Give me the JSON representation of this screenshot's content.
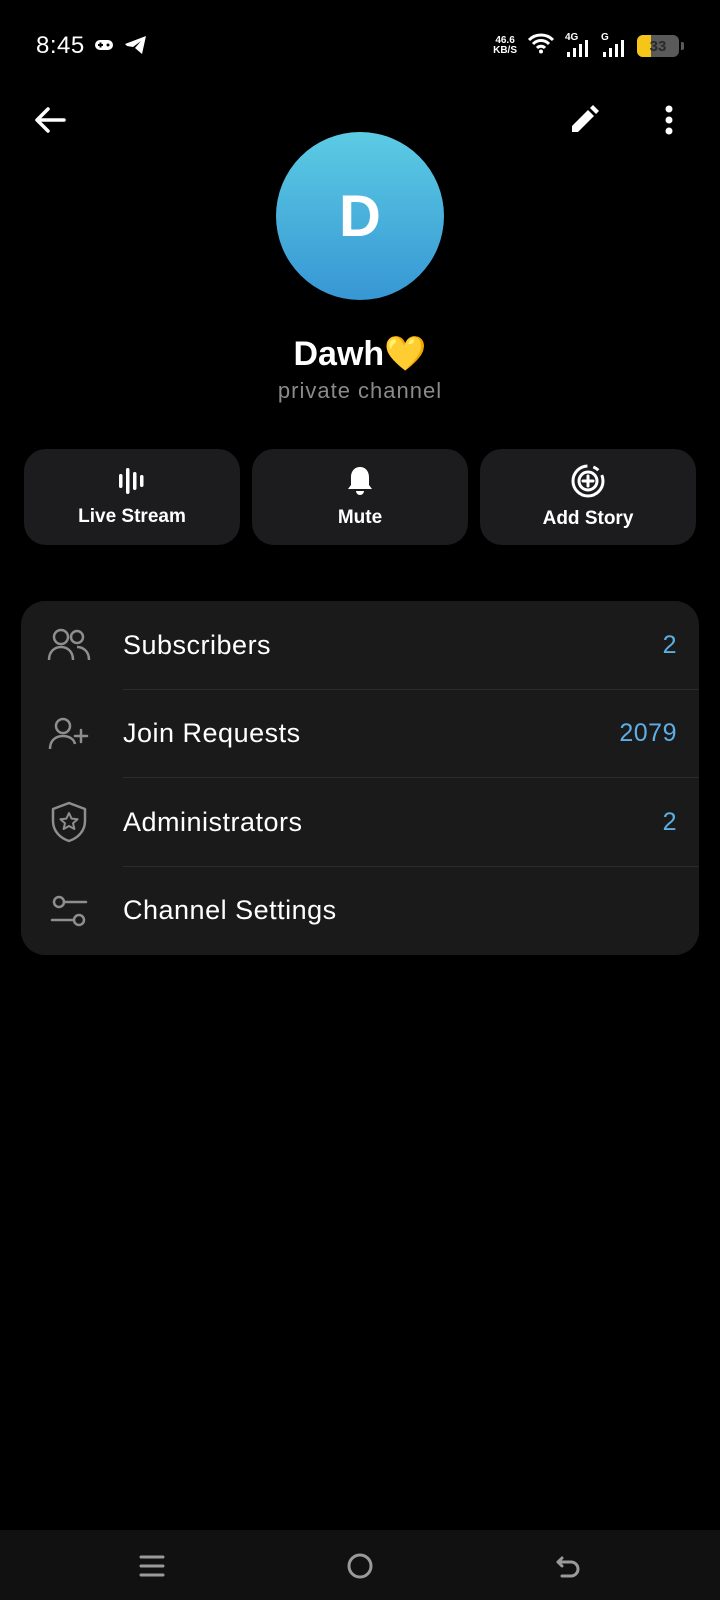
{
  "status_bar": {
    "time": "8:45",
    "net_speed_value": "46.6",
    "net_speed_unit": "KB/S",
    "signal1_label": "4G",
    "signal2_label": "G",
    "battery_level": "33",
    "icons": [
      "gamepad-icon",
      "telegram-icon",
      "wifi-icon",
      "signal-icon",
      "battery-icon"
    ]
  },
  "top_bar": {
    "icons": [
      "back-arrow-icon",
      "pencil-icon",
      "more-vertical-icon"
    ]
  },
  "profile": {
    "avatar_letter": "D",
    "avatar_colors": [
      "#5ccbe3",
      "#3797d4"
    ],
    "name": "Dawh💛",
    "subtitle": "private channel"
  },
  "actions": [
    {
      "label": "Live Stream",
      "icon": "live-stream-icon"
    },
    {
      "label": "Mute",
      "icon": "bell-icon"
    },
    {
      "label": "Add Story",
      "icon": "add-story-icon"
    }
  ],
  "list": [
    {
      "label": "Subscribers",
      "value": "2",
      "icon": "users-icon"
    },
    {
      "label": "Join Requests",
      "value": "2079",
      "icon": "user-plus-icon"
    },
    {
      "label": "Administrators",
      "value": "2",
      "icon": "shield-star-icon"
    },
    {
      "label": "Channel Settings",
      "value": "",
      "icon": "sliders-icon"
    }
  ],
  "colors": {
    "accent": "#5eaee6",
    "card_bg": "#1a1a1a",
    "background": "#000000"
  },
  "nav_bar": {
    "icons": [
      "menu-icon",
      "home-circle-icon",
      "back-icon"
    ]
  }
}
